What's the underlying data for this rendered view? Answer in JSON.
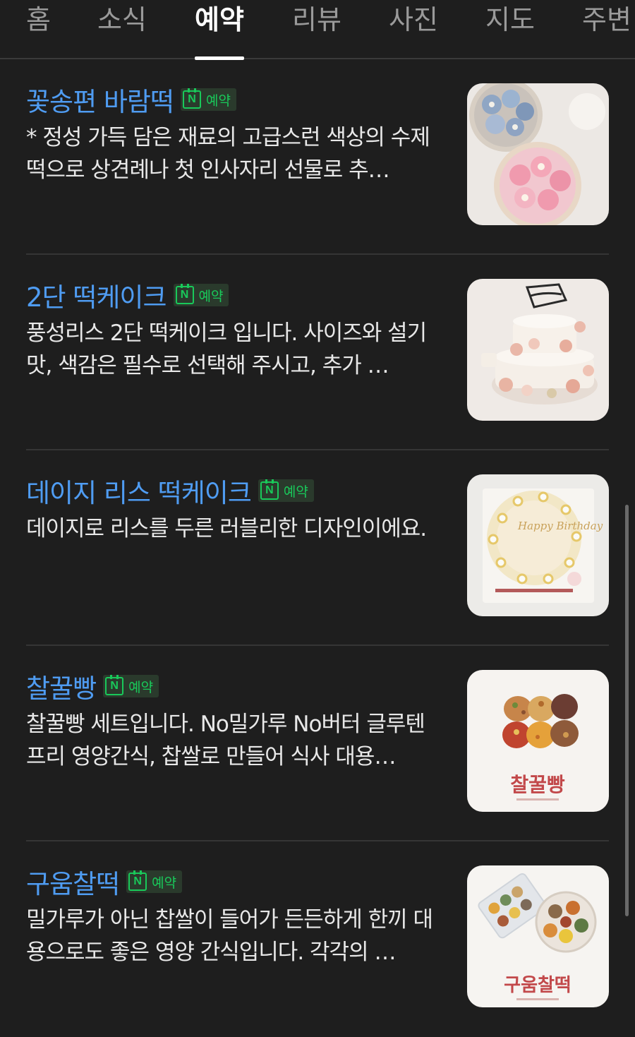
{
  "tabs": [
    {
      "label": "홈",
      "active": false
    },
    {
      "label": "소식",
      "active": false
    },
    {
      "label": "예약",
      "active": true
    },
    {
      "label": "리뷰",
      "active": false
    },
    {
      "label": "사진",
      "active": false
    },
    {
      "label": "지도",
      "active": false
    },
    {
      "label": "주변",
      "active": false
    }
  ],
  "badge_label": "예약",
  "badge_icon": "N",
  "items": [
    {
      "title": "꽃송편 바람떡",
      "desc": "* 정성 가득 담은 재료의 고급스런 색상의 수제떡으로 상견례나 첫 인사자리 선물로 추…",
      "image_icon": "songpyeon-photo"
    },
    {
      "title": "2단 떡케이크",
      "desc": "풍성리스 2단 떡케이크 입니다. 사이즈와 설기 맛, 색감은 필수로 선택해 주시고, 추가 …",
      "image_icon": "two-tier-cake-photo"
    },
    {
      "title": "데이지 리스 떡케이크",
      "desc": "데이지로 리스를 두른 러블리한 디자인이에요.",
      "image_icon": "daisy-cake-photo",
      "image_text": "Happy Birthday"
    },
    {
      "title": "찰꿀빵",
      "desc": "찰꿀빵 세트입니다. No밀가루 No버터 글루텐프리 영양간식, 찹쌀로 만들어 식사 대용…",
      "image_icon": "chalkkulppang-photo",
      "image_text": "찰꿀빵"
    },
    {
      "title": "구움찰떡",
      "desc": "밀가루가 아닌 찹쌀이 들어가 든든하게 한끼 대용으로도 좋은 영양 간식입니다. 각각의 …",
      "image_icon": "guumchaltteok-photo",
      "image_text": "구움찰떡"
    }
  ]
}
